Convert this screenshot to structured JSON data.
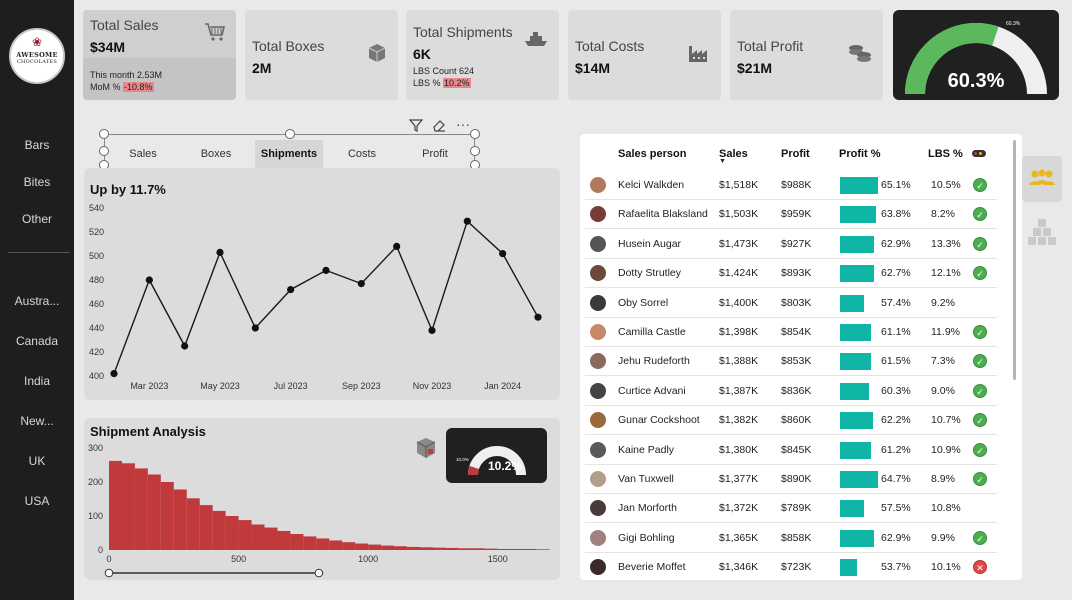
{
  "brand": {
    "line1": "AWESOME",
    "line2": "CHOCOLATES"
  },
  "sidebar": {
    "products": [
      "Bars",
      "Bites",
      "Other"
    ],
    "countries": [
      "Austra...",
      "Canada",
      "India",
      "New...",
      "UK",
      "USA"
    ]
  },
  "kpis": {
    "sales": {
      "title": "Total Sales",
      "value": "$34M",
      "sub1": "This month 2.53M",
      "sub2_label": "MoM % ",
      "sub2_value": "-10.8%"
    },
    "boxes": {
      "title": "Total Boxes",
      "value": "2M"
    },
    "shipments": {
      "title": "Total Shipments",
      "value": "6K",
      "sub1": "LBS Count 624",
      "sub2_label": "LBS % ",
      "sub2_value": "10.2%"
    },
    "costs": {
      "title": "Total Costs",
      "value": "$14M"
    },
    "profit": {
      "title": "Total Profit",
      "value": "$21M"
    },
    "gauge": {
      "value": "60.3%",
      "small_label": "60.3%",
      "fraction": 0.603
    }
  },
  "tabs": [
    "Sales",
    "Boxes",
    "Shipments",
    "Costs",
    "Profit"
  ],
  "selected_tab": "Shipments",
  "line_panel": {
    "title": "Up by 11.7%"
  },
  "shipment_panel": {
    "title": "Shipment Analysis",
    "gauge_value": "10.2%",
    "gauge_small": "10.0%",
    "gauge_fraction": 0.102
  },
  "table": {
    "headers": {
      "person": "Sales person",
      "sales": "Sales",
      "profit": "Profit",
      "profit_pct": "Profit %",
      "lbs_pct": "LBS %"
    },
    "rows": [
      {
        "name": "Kelci Walkden",
        "sales": "$1,518K",
        "profit": "$988K",
        "pct": "65.1%",
        "pctv": 65.1,
        "lbs": "10.5%",
        "status": "ok"
      },
      {
        "name": "Rafaelita Blaksland",
        "sales": "$1,503K",
        "profit": "$959K",
        "pct": "63.8%",
        "pctv": 63.8,
        "lbs": "8.2%",
        "status": "ok"
      },
      {
        "name": "Husein Augar",
        "sales": "$1,473K",
        "profit": "$927K",
        "pct": "62.9%",
        "pctv": 62.9,
        "lbs": "13.3%",
        "status": "ok"
      },
      {
        "name": "Dotty Strutley",
        "sales": "$1,424K",
        "profit": "$893K",
        "pct": "62.7%",
        "pctv": 62.7,
        "lbs": "12.1%",
        "status": "ok"
      },
      {
        "name": "Oby Sorrel",
        "sales": "$1,400K",
        "profit": "$803K",
        "pct": "57.4%",
        "pctv": 57.4,
        "lbs": "9.2%",
        "status": "none"
      },
      {
        "name": "Camilla Castle",
        "sales": "$1,398K",
        "profit": "$854K",
        "pct": "61.1%",
        "pctv": 61.1,
        "lbs": "11.9%",
        "status": "ok"
      },
      {
        "name": "Jehu Rudeforth",
        "sales": "$1,388K",
        "profit": "$853K",
        "pct": "61.5%",
        "pctv": 61.5,
        "lbs": "7.3%",
        "status": "ok"
      },
      {
        "name": "Curtice Advani",
        "sales": "$1,387K",
        "profit": "$836K",
        "pct": "60.3%",
        "pctv": 60.3,
        "lbs": "9.0%",
        "status": "ok"
      },
      {
        "name": "Gunar Cockshoot",
        "sales": "$1,382K",
        "profit": "$860K",
        "pct": "62.2%",
        "pctv": 62.2,
        "lbs": "10.7%",
        "status": "ok"
      },
      {
        "name": "Kaine Padly",
        "sales": "$1,380K",
        "profit": "$845K",
        "pct": "61.2%",
        "pctv": 61.2,
        "lbs": "10.9%",
        "status": "ok"
      },
      {
        "name": "Van Tuxwell",
        "sales": "$1,377K",
        "profit": "$890K",
        "pct": "64.7%",
        "pctv": 64.7,
        "lbs": "8.9%",
        "status": "ok"
      },
      {
        "name": "Jan Morforth",
        "sales": "$1,372K",
        "profit": "$789K",
        "pct": "57.5%",
        "pctv": 57.5,
        "lbs": "10.8%",
        "status": "none"
      },
      {
        "name": "Gigi Bohling",
        "sales": "$1,365K",
        "profit": "$858K",
        "pct": "62.9%",
        "pctv": 62.9,
        "lbs": "9.9%",
        "status": "ok"
      },
      {
        "name": "Beverie Moffet",
        "sales": "$1,346K",
        "profit": "$723K",
        "pct": "53.7%",
        "pctv": 53.7,
        "lbs": "10.1%",
        "status": "bad"
      }
    ]
  },
  "chart_data": [
    {
      "type": "line",
      "title": "Up by 11.7%",
      "x": [
        "Feb 2023",
        "Mar 2023",
        "Apr 2023",
        "May 2023",
        "Jun 2023",
        "Jul 2023",
        "Aug 2023",
        "Sep 2023",
        "Oct 2023",
        "Nov 2023",
        "Dec 2023",
        "Jan 2024",
        "Feb 2024"
      ],
      "values": [
        402,
        480,
        425,
        503,
        440,
        472,
        488,
        477,
        508,
        438,
        529,
        502,
        449
      ],
      "x_tick_labels": [
        "Mar 2023",
        "May 2023",
        "Jul 2023",
        "Sep 2023",
        "Nov 2023",
        "Jan 2024"
      ],
      "y_ticks": [
        400,
        420,
        440,
        460,
        480,
        500,
        520,
        540
      ],
      "ylim": [
        400,
        540
      ],
      "grid": false
    },
    {
      "type": "area",
      "title": "Shipment Analysis",
      "x_ticks": [
        0,
        500,
        1000,
        1500
      ],
      "y_ticks": [
        0,
        100,
        200,
        300
      ],
      "xlim": [
        0,
        1690
      ],
      "ylim": [
        0,
        300
      ],
      "x": [
        0,
        50,
        100,
        150,
        200,
        250,
        300,
        350,
        400,
        450,
        500,
        550,
        600,
        650,
        700,
        750,
        800,
        850,
        900,
        950,
        1000,
        1050,
        1100,
        1150,
        1200,
        1250,
        1300,
        1350,
        1400,
        1450,
        1500,
        1550,
        1600,
        1650
      ],
      "values": [
        262,
        255,
        240,
        222,
        200,
        178,
        152,
        132,
        115,
        100,
        88,
        75,
        66,
        56,
        47,
        40,
        34,
        28,
        23,
        19,
        16,
        13,
        11,
        9,
        8,
        7,
        6,
        5,
        5,
        4,
        3,
        3,
        3,
        2
      ],
      "highlight_range": [
        0,
        60
      ],
      "color": "#c0393b"
    }
  ],
  "colors": {
    "accent_green": "#5bb85d",
    "teal": "#0fb5a5",
    "red": "#c0393b",
    "dark": "#202020"
  }
}
